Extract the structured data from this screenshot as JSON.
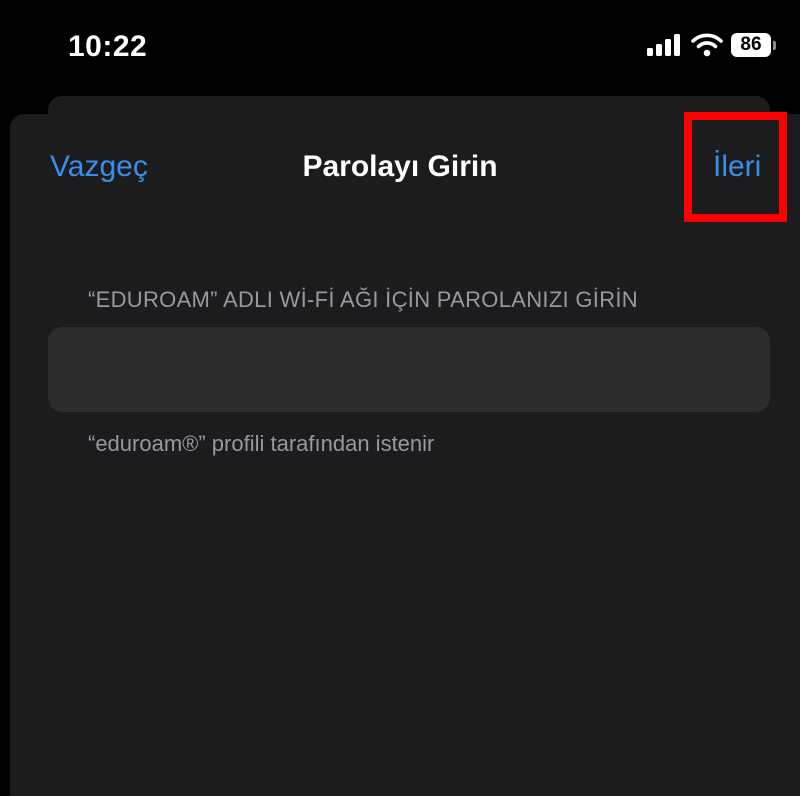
{
  "status_bar": {
    "time": "10:22",
    "battery_level": "86",
    "icons": [
      "signal-icon",
      "wifi-icon",
      "battery-icon"
    ]
  },
  "nav": {
    "cancel_label": "Vazgeç",
    "title": "Parolayı Girin",
    "next_label": "İleri"
  },
  "form": {
    "header": "“EDUROAM” ADLI Wİ-Fİ AĞI İÇİN PAROLANIZI GİRİN",
    "password_value": "",
    "password_placeholder": "",
    "footer": "“eduroam®” profili tarafından istenir"
  },
  "colors": {
    "accent": "#3a8ee8",
    "sheet_background": "#1c1c1e",
    "field_background": "#2c2c2e",
    "secondary_text": "#98989f",
    "highlight": "#ff0000"
  }
}
